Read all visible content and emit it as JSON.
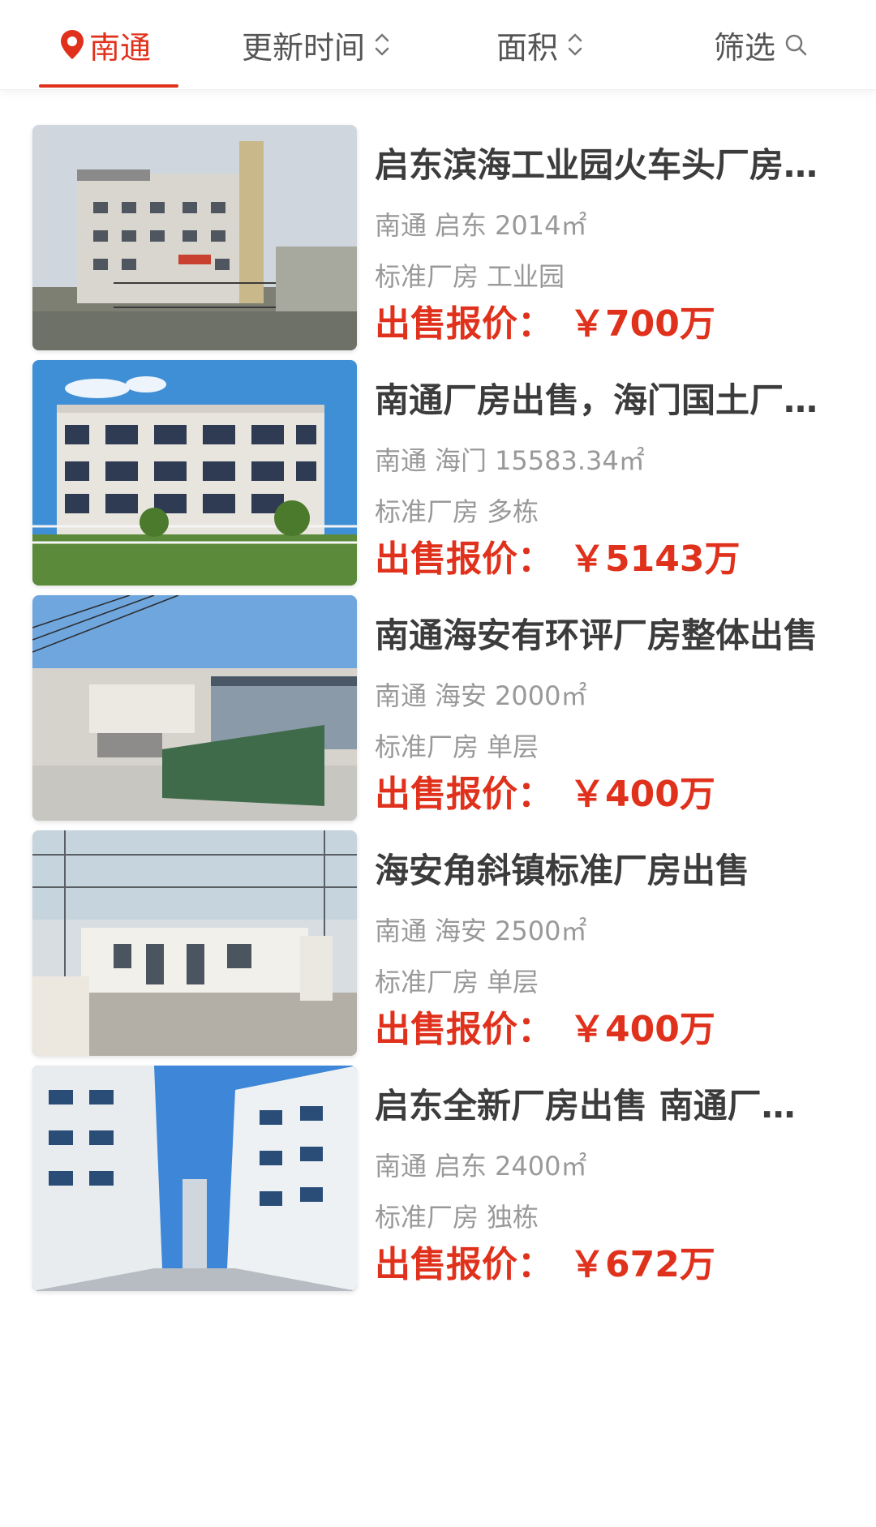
{
  "filter_bar": {
    "city": "南通",
    "sort_time": "更新时间",
    "sort_area": "面积",
    "filter": "筛选"
  },
  "colors": {
    "accent": "#e0311c",
    "title": "#3c3c3c",
    "meta": "#999999"
  },
  "listings": [
    {
      "title": "启东滨海工业园火车头厂房出售",
      "city": "南通",
      "district": "启东",
      "area": "2014㎡",
      "tag1": "标准厂房",
      "tag2": "工业园",
      "price_label": "出售报价：",
      "price": "￥700万"
    },
    {
      "title": "南通厂房出售，海门国土厂房出售",
      "city": "南通",
      "district": "海门",
      "area": "15583.34㎡",
      "tag1": "标准厂房",
      "tag2": "多栋",
      "price_label": "出售报价：",
      "price": "￥5143万"
    },
    {
      "title": "南通海安有环评厂房整体出售",
      "city": "南通",
      "district": "海安",
      "area": "2000㎡",
      "tag1": "标准厂房",
      "tag2": "单层",
      "price_label": "出售报价：",
      "price": "￥400万"
    },
    {
      "title": "海安角斜镇标准厂房出售",
      "city": "南通",
      "district": "海安",
      "area": "2500㎡",
      "tag1": "标准厂房",
      "tag2": "单层",
      "price_label": "出售报价：",
      "price": "￥400万"
    },
    {
      "title": "启东全新厂房出售 南通厂房出售",
      "city": "南通",
      "district": "启东",
      "area": "2400㎡",
      "tag1": "标准厂房",
      "tag2": "独栋",
      "price_label": "出售报价：",
      "price": "￥672万"
    }
  ]
}
